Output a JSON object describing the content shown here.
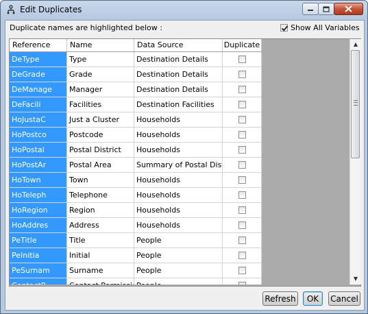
{
  "window": {
    "title": "Edit Duplicates",
    "minimize": "0",
    "maximize": "1",
    "close": "r"
  },
  "hint": "Duplicate names are highlighted below :",
  "show_all": {
    "label": "Show All Variables",
    "checked": true
  },
  "table": {
    "columns": [
      "Reference",
      "Name",
      "Data Source",
      "Duplicate"
    ],
    "rows": [
      {
        "reference": "DeType",
        "name": "Type",
        "source": "Destination Details",
        "duplicate": false
      },
      {
        "reference": "DeGrade",
        "name": "Grade",
        "source": "Destination Details",
        "duplicate": false
      },
      {
        "reference": "DeManage",
        "name": "Manager",
        "source": "Destination Details",
        "duplicate": false
      },
      {
        "reference": "DeFacili",
        "name": "Facilities",
        "source": "Destination Facilities",
        "duplicate": false
      },
      {
        "reference": "HoJustaC",
        "name": "Just a Cluster",
        "source": "Households",
        "duplicate": false
      },
      {
        "reference": "HoPostco",
        "name": "Postcode",
        "source": "Households",
        "duplicate": false
      },
      {
        "reference": "HoPostal",
        "name": "Postal District",
        "source": "Households",
        "duplicate": false
      },
      {
        "reference": "HoPostAr",
        "name": "Postal Area",
        "source": "Summary of Postal District",
        "duplicate": false
      },
      {
        "reference": "HoTown",
        "name": "Town",
        "source": "Households",
        "duplicate": false
      },
      {
        "reference": "HoTeleph",
        "name": "Telephone",
        "source": "Households",
        "duplicate": false
      },
      {
        "reference": "HoRegion",
        "name": "Region",
        "source": "Households",
        "duplicate": false
      },
      {
        "reference": "HoAddres",
        "name": "Address",
        "source": "Households",
        "duplicate": false
      },
      {
        "reference": "PeTitle",
        "name": "Title",
        "source": "People",
        "duplicate": false
      },
      {
        "reference": "PeInitia",
        "name": "Initial",
        "source": "People",
        "duplicate": false
      },
      {
        "reference": "PeSurnam",
        "name": "Surname",
        "source": "People",
        "duplicate": false
      },
      {
        "reference": "ContactP",
        "name": "Contact Permission",
        "source": "People",
        "duplicate": false
      }
    ]
  },
  "buttons": {
    "refresh": "Refresh",
    "ok": "OK",
    "cancel": "Cancel"
  },
  "colors": {
    "highlight": "#3399ff"
  }
}
